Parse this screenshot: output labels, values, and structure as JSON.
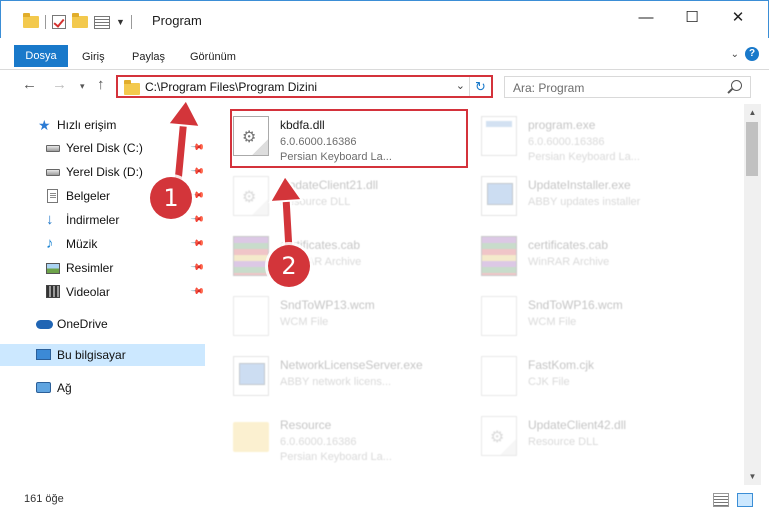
{
  "window": {
    "title": "Program",
    "minimize": "—",
    "maximize": "☐",
    "close": "✕"
  },
  "ribbon": {
    "tabs": [
      "Dosya",
      "Giriş",
      "Paylaş",
      "Görünüm"
    ]
  },
  "nav": {
    "address": "C:\\Program Files\\Program Dizini",
    "search_placeholder": "Ara: Program"
  },
  "sidebar": {
    "items": [
      {
        "label": "Hızlı erişim",
        "icon": "star-icon"
      },
      {
        "label": "Yerel Disk (C:)",
        "icon": "drive-icon",
        "pinned": true
      },
      {
        "label": "Yerel Disk (D:)",
        "icon": "drive-icon",
        "pinned": true
      },
      {
        "label": "Belgeler",
        "icon": "documents-icon",
        "pinned": true
      },
      {
        "label": "İndirmeler",
        "icon": "download-icon",
        "pinned": true
      },
      {
        "label": "Müzik",
        "icon": "music-icon",
        "pinned": true
      },
      {
        "label": "Resimler",
        "icon": "pictures-icon",
        "pinned": true
      },
      {
        "label": "Videolar",
        "icon": "videos-icon",
        "pinned": true
      },
      {
        "label": "OneDrive",
        "icon": "onedrive-icon"
      },
      {
        "label": "Bu bilgisayar",
        "icon": "computer-icon",
        "selected": true
      },
      {
        "label": "Ağ",
        "icon": "network-icon"
      }
    ]
  },
  "files": [
    {
      "name": "kbdfa.dll",
      "line2": "6.0.6000.16386",
      "line3": "Persian Keyboard La...",
      "icon": "dll-icon"
    },
    {
      "name": "program.exe",
      "line2": "6.0.6000.16386",
      "line3": "Persian Keyboard La...",
      "icon": "exe-icon"
    },
    {
      "name": "UpdateClient21.dll",
      "line2": "Resource DLL",
      "line3": "",
      "icon": "dll-icon"
    },
    {
      "name": "UpdateInstaller.exe",
      "line2": "ABBY updates installer",
      "line3": "",
      "icon": "window-icon"
    },
    {
      "name": "certificates.cab",
      "line2": "WinRAR Archive",
      "line3": "",
      "icon": "archive-icon"
    },
    {
      "name": "certificates.cab",
      "line2": "WinRAR Archive",
      "line3": "",
      "icon": "archive-icon"
    },
    {
      "name": "SndToWP13.wcm",
      "line2": "WCM File",
      "line3": "",
      "icon": "blank-file-icon"
    },
    {
      "name": "SndToWP16.wcm",
      "line2": "WCM File",
      "line3": "",
      "icon": "blank-file-icon"
    },
    {
      "name": "NetworkLicenseServer.exe",
      "line2": "ABBY network licens...",
      "line3": "",
      "icon": "window-icon"
    },
    {
      "name": "FastKom.cjk",
      "line2": "CJK File",
      "line3": "",
      "icon": "blank-file-icon"
    },
    {
      "name": "Resource",
      "line2": "6.0.6000.16386",
      "line3": "Persian Keyboard La...",
      "icon": "folder-icon"
    },
    {
      "name": "UpdateClient42.dll",
      "line2": "Resource DLL",
      "line3": "",
      "icon": "dll-icon"
    }
  ],
  "status": {
    "count": "161 öğe"
  },
  "annotations": {
    "step1": "1",
    "step2": "2",
    "color": "#d3353a"
  }
}
